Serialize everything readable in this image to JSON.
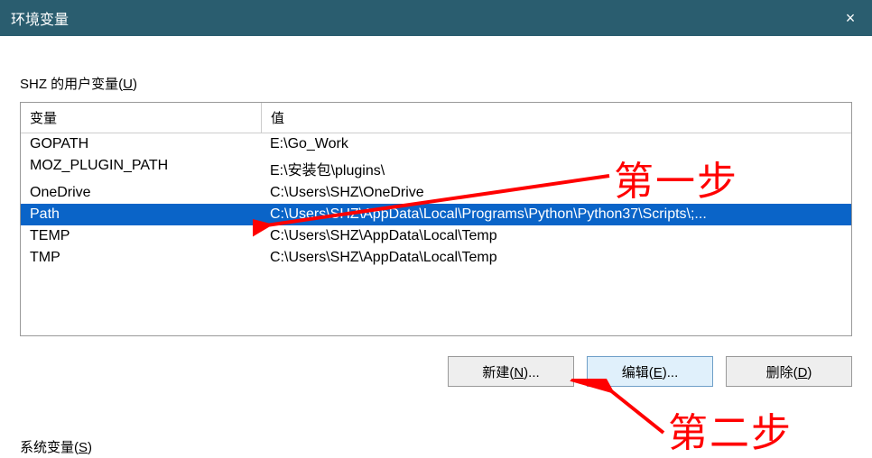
{
  "titlebar": {
    "title": "环境变量",
    "close": "×"
  },
  "sections": {
    "user_vars_label_prefix": "SHZ 的用户变量(",
    "user_vars_hotkey": "U",
    "user_vars_label_suffix": ")",
    "system_vars_label_prefix": "系统变量(",
    "system_vars_hotkey": "S",
    "system_vars_label_suffix": ")"
  },
  "table": {
    "header_var": "变量",
    "header_val": "值",
    "rows": [
      {
        "var": "GOPATH",
        "val": "E:\\Go_Work",
        "selected": false
      },
      {
        "var": "MOZ_PLUGIN_PATH",
        "val": "E:\\安装包\\plugins\\",
        "selected": false
      },
      {
        "var": "OneDrive",
        "val": "C:\\Users\\SHZ\\OneDrive",
        "selected": false
      },
      {
        "var": "Path",
        "val": "C:\\Users\\SHZ\\AppData\\Local\\Programs\\Python\\Python37\\Scripts\\;...",
        "selected": true
      },
      {
        "var": "TEMP",
        "val": "C:\\Users\\SHZ\\AppData\\Local\\Temp",
        "selected": false
      },
      {
        "var": "TMP",
        "val": "C:\\Users\\SHZ\\AppData\\Local\\Temp",
        "selected": false
      }
    ]
  },
  "buttons": {
    "new_prefix": "新建(",
    "new_hotkey": "N",
    "new_suffix": ")...",
    "edit_prefix": "编辑(",
    "edit_hotkey": "E",
    "edit_suffix": ")...",
    "delete_prefix": "删除(",
    "delete_hotkey": "D",
    "delete_suffix": ")"
  },
  "annotations": {
    "step1": "第一步",
    "step2": "第二步"
  }
}
